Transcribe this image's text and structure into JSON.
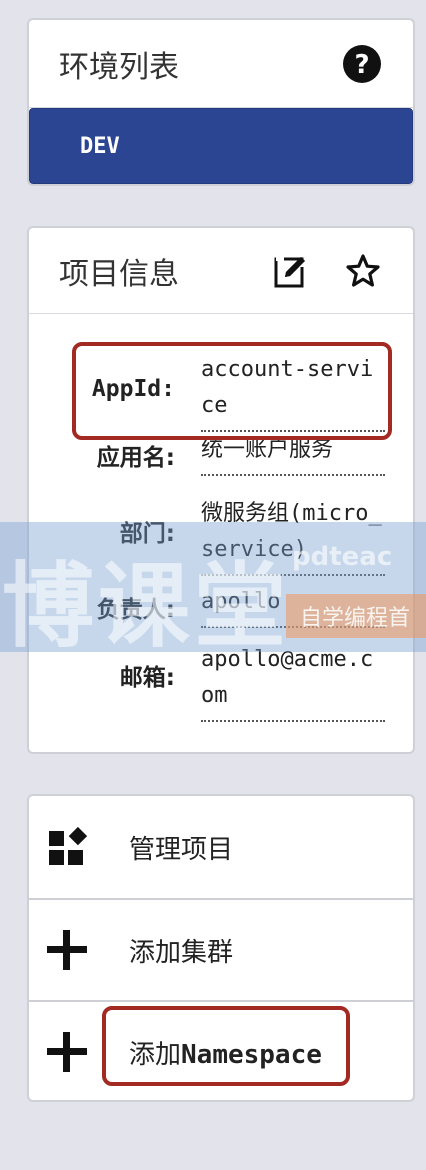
{
  "env_panel": {
    "title": "环境列表",
    "help_icon": "question-circle-icon",
    "environments": [
      {
        "label": "DEV",
        "active": true
      }
    ]
  },
  "info_panel": {
    "title": "项目信息",
    "edit_icon": "edit-icon",
    "star_icon": "star-icon",
    "fields": {
      "appid": {
        "label": "AppId:",
        "value": "account-service"
      },
      "name": {
        "label": "应用名:",
        "value": "统一账户服务"
      },
      "dept": {
        "label": "部门:",
        "value": "微服务组(micro_service)"
      },
      "owner": {
        "label": "负责人:",
        "value": "apollo"
      },
      "email": {
        "label": "邮箱:",
        "value": "apollo@acme.com"
      }
    }
  },
  "actions_panel": {
    "items": [
      {
        "label": "管理项目",
        "icon": "grid-shapes-icon"
      },
      {
        "label": "添加集群",
        "icon": "plus-icon"
      },
      {
        "label_prefix": "添加",
        "label_suffix": "Namespace",
        "icon": "plus-icon"
      }
    ]
  },
  "watermark": {
    "main": "博课堂",
    "sub": "pdteac",
    "tag": "自学编程首"
  },
  "colors": {
    "env_active": "#2b4592",
    "highlight": "#a32a22",
    "background": "#e3e3ec"
  }
}
